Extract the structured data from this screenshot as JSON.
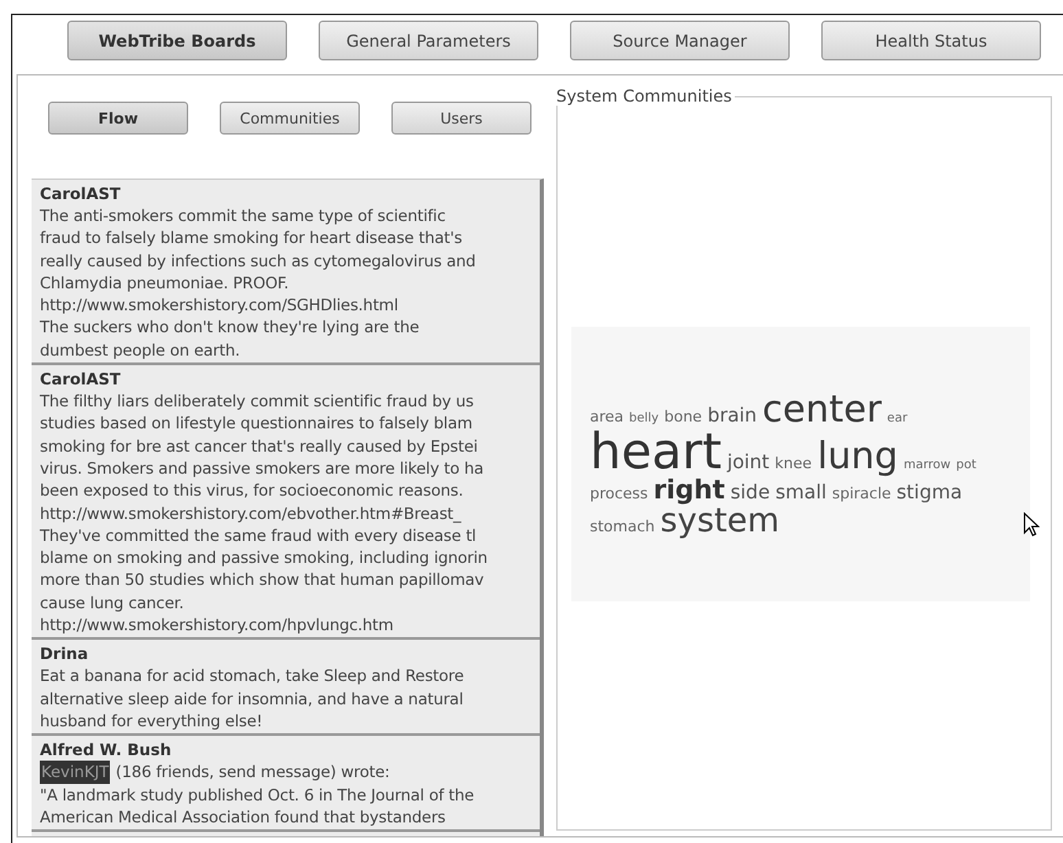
{
  "tabs": [
    {
      "label": "WebTribe Boards",
      "selected": true
    },
    {
      "label": "General Parameters",
      "selected": false
    },
    {
      "label": "Source Manager",
      "selected": false
    },
    {
      "label": "Health Status",
      "selected": false
    }
  ],
  "views": [
    {
      "label": "Flow",
      "selected": true
    },
    {
      "label": "Communities",
      "selected": false
    },
    {
      "label": "Users",
      "selected": false
    }
  ],
  "posts": [
    {
      "author": "CarolAST",
      "lines": [
        "The anti-smokers commit the same type of scientific",
        "fraud to falsely blame smoking for heart disease that's",
        "really caused by infections such as cytomegalovirus and",
        "Chlamydia pneumoniae. PROOF.",
        "http://www.smokershistory.com/SGHDlies.html",
        "The suckers who don't know they're lying are the",
        "dumbest people on earth."
      ]
    },
    {
      "author": "CarolAST",
      "lines": [
        "The filthy liars deliberately commit scientific fraud by us",
        "studies based on lifestyle questionnaires to falsely blam",
        "smoking for bre ast cancer that's really caused by Epstei",
        "virus. Smokers and passive smokers are more likely to ha",
        "been exposed to this virus, for socioeconomic reasons.",
        "http://www.smokershistory.com/ebvother.htm#Breast_",
        "They've committed the same fraud with every disease tl",
        "blame on smoking and passive smoking, including ignorin",
        "more than 50 studies which show that human papillomav",
        "cause lung cancer.",
        "http://www.smokershistory.com/hpvlungc.htm"
      ]
    },
    {
      "author": "Drina",
      "lines": [
        "Eat a banana for acid stomach, take Sleep and Restore",
        "alternative sleep aide for insomnia, and have a natural",
        "husband for everything else!"
      ]
    },
    {
      "author": "Alfred W. Bush",
      "mention": "KevinKJT",
      "lines": [
        "(186 friends, send message) wrote:",
        "\"A landmark study published Oct. 6 in The Journal of the",
        "American Medical Association found that bystanders"
      ]
    }
  ],
  "communities": {
    "title": "System Communities",
    "words": [
      {
        "text": "area",
        "kind": "small"
      },
      {
        "text": "belly",
        "kind": "tiny"
      },
      {
        "text": "bone",
        "kind": "small"
      },
      {
        "text": "brain",
        "kind": "medium"
      },
      {
        "text": "center",
        "kind": "huge"
      },
      {
        "text": "ear",
        "kind": "tiny"
      },
      {
        "text": "heart",
        "kind": "giant"
      },
      {
        "text": "joint",
        "kind": "medium"
      },
      {
        "text": "knee",
        "kind": "small"
      },
      {
        "text": "lung",
        "kind": "huge"
      },
      {
        "text": "marrow",
        "kind": "tiny"
      },
      {
        "text": "pot",
        "kind": "tiny"
      },
      {
        "text": "process",
        "kind": "small"
      },
      {
        "text": "right",
        "kind": "bold"
      },
      {
        "text": "side",
        "kind": "medium"
      },
      {
        "text": "small",
        "kind": "medium"
      },
      {
        "text": "spiracle",
        "kind": "small"
      },
      {
        "text": "stigma",
        "kind": "medium"
      },
      {
        "text": "stomach",
        "kind": "small"
      },
      {
        "text": "system",
        "kind": "large"
      }
    ]
  }
}
